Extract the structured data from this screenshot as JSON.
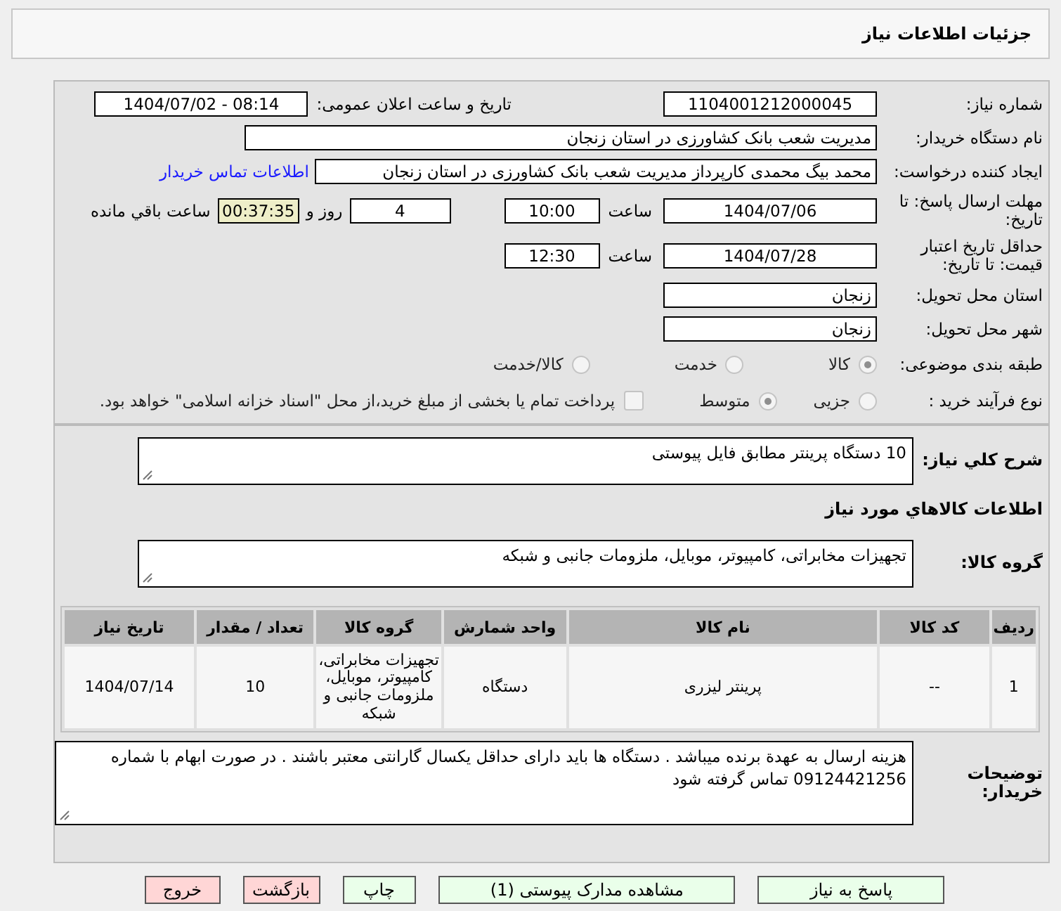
{
  "title": "جزئیات اطلاعات نیاز",
  "need_number": {
    "label": "شماره نیاز:",
    "value": "1104001212000045"
  },
  "announce": {
    "label": "تاریخ و ساعت اعلان عمومی:",
    "value": "1404/07/02 - 08:14"
  },
  "buyer": {
    "label": "نام دستگاه خریدار:",
    "value": "مدیریت شعب بانک کشاورزی در استان زنجان"
  },
  "requester": {
    "label": "ایجاد کننده درخواست:",
    "value": "محمد بیگ محمدی کارپرداز مدیریت شعب بانک کشاورزی در استان زنجان",
    "link": "اطلاعات تماس خریدار"
  },
  "reply_deadline": {
    "label": "مهلت ارسال پاسخ: تا تاریخ:",
    "date": "1404/07/06",
    "time_label": "ساعت",
    "time": "10:00",
    "days": "4",
    "days_label": "روز و",
    "remaining": "00:37:35",
    "remaining_label": "ساعت باقي مانده"
  },
  "price_validity": {
    "label": "حداقل تاریخ اعتبار قیمت: تا تاریخ:",
    "date": "1404/07/28",
    "time_label": "ساعت",
    "time": "12:30"
  },
  "province": {
    "label": "استان محل تحویل:",
    "value": "زنجان"
  },
  "city": {
    "label": "شهر محل تحویل:",
    "value": "زنجان"
  },
  "category": {
    "label": "طبقه بندی موضوعی:",
    "options": [
      {
        "label": "کالا",
        "selected": true
      },
      {
        "label": "خدمت",
        "selected": false
      },
      {
        "label": "کالا/خدمت",
        "selected": false
      }
    ]
  },
  "process": {
    "label": "نوع فرآیند خرید :",
    "options": [
      {
        "label": "جزیی",
        "selected": false
      },
      {
        "label": "متوسط",
        "selected": true
      }
    ],
    "payment": {
      "label": "پرداخت تمام یا بخشی از مبلغ خرید،از محل \"اسناد خزانه اسلامی\" خواهد بود.",
      "checked": false
    }
  },
  "description": {
    "label": "شرح كلي نياز:",
    "value": "10 دستگاه پرینتر مطابق فایل پیوستی"
  },
  "goods_heading": "اطلاعات كالاهاي مورد نياز",
  "goods_group": {
    "label": "گروه کالا:",
    "value": "تجهیزات مخابراتی، کامپیوتر، موبایل، ملزومات جانبی و شبکه"
  },
  "table": {
    "columns": [
      "ردیف",
      "کد کالا",
      "نام کالا",
      "واحد شمارش",
      "گروه کالا",
      "تعداد / مقدار",
      "تاریخ نیاز"
    ],
    "rows": [
      [
        "1",
        "--",
        "پرینتر لیزری",
        "دستگاه",
        "تجهیزات مخابراتی، کامپیوتر، موبایل، ملزومات جانبی و شبکه",
        "10",
        "1404/07/14"
      ]
    ]
  },
  "buyer_notes": {
    "label": "توضیحات خریدار:",
    "value": "هزینه ارسال به عهدة برنده میباشد . دستگاه ها باید دارای حداقل یکسال گارانتی معتبر باشند . در صورت ابهام با شماره 09124421256 تماس گرفته شود"
  },
  "buttons": [
    {
      "label": "پاسخ به نیاز",
      "kind": "primary"
    },
    {
      "label": "مشاهده مدارک پیوستی (1)",
      "kind": "primary"
    },
    {
      "label": "چاپ",
      "kind": "primary"
    },
    {
      "label": "بازگشت",
      "kind": "danger"
    },
    {
      "label": "خروج",
      "kind": "danger"
    }
  ]
}
